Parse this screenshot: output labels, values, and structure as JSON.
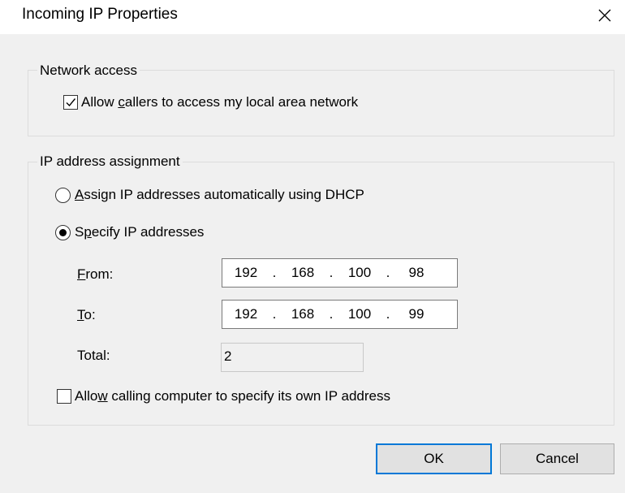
{
  "dialog": {
    "title": "Incoming IP Properties",
    "close_icon": "close-icon"
  },
  "network_access": {
    "legend": "Network access",
    "allow_lan": {
      "label_pre": "Allow ",
      "label_accel": "c",
      "label_post": "allers to access my local area network",
      "checked": true
    }
  },
  "ip_assignment": {
    "legend": "IP address assignment",
    "dhcp": {
      "label_accel": "A",
      "label_post": "ssign IP addresses automatically using DHCP",
      "selected": false
    },
    "specify": {
      "label_pre": "S",
      "label_accel": "p",
      "label_post": "ecify IP addresses",
      "selected": true
    },
    "from": {
      "label_accel": "F",
      "label_post": "rom:",
      "octets": [
        "192",
        "168",
        "100",
        "98"
      ]
    },
    "to": {
      "label_accel": "T",
      "label_post": "o:",
      "octets": [
        "192",
        "168",
        "100",
        "99"
      ]
    },
    "total": {
      "label": "Total:",
      "value": "2"
    },
    "allow_specify": {
      "label_pre": "Allo",
      "label_accel": "w",
      "label_post": " calling computer to specify its own IP address",
      "checked": false
    }
  },
  "buttons": {
    "ok": "OK",
    "cancel": "Cancel"
  },
  "colors": {
    "accent": "#0078d7",
    "background": "#f0f0f0"
  }
}
